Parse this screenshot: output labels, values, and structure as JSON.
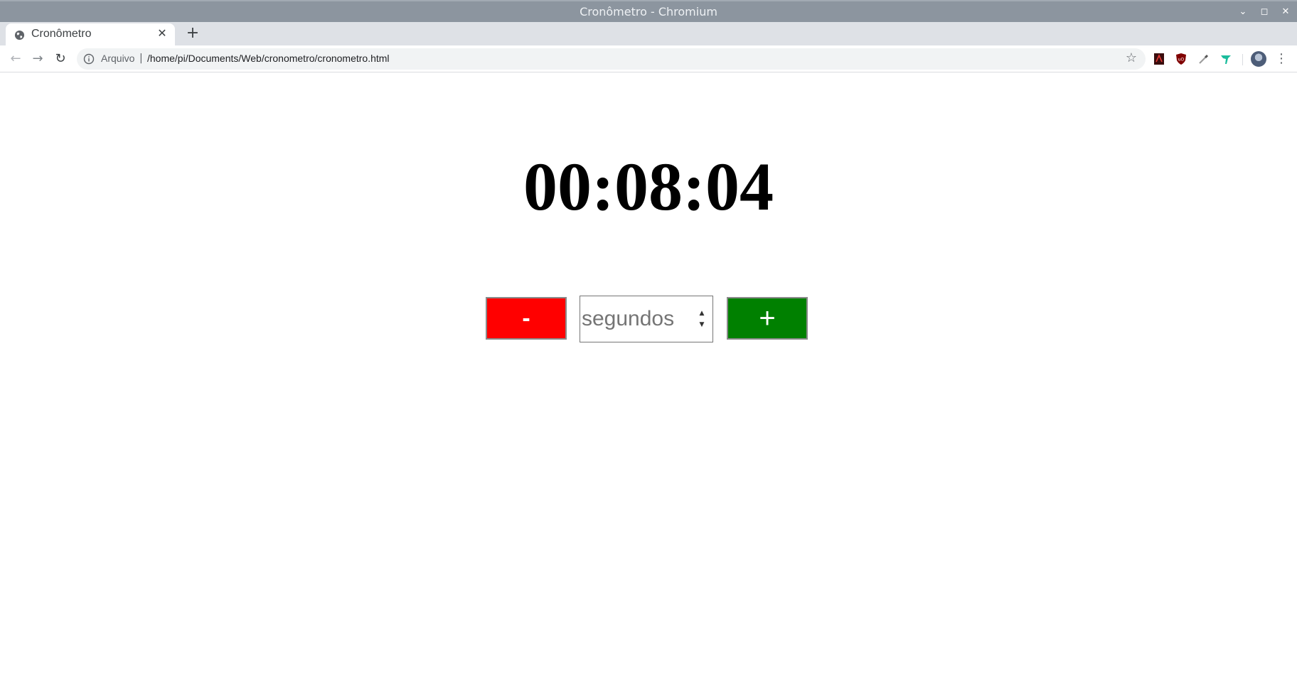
{
  "window": {
    "title": "Cronômetro - Chromium",
    "controls": {
      "minimize": "⌄",
      "maximize": "◻",
      "close": "✕"
    }
  },
  "tabs": [
    {
      "title": "Cronômetro",
      "icon": "globe-icon",
      "active": true
    }
  ],
  "tabstrip": {
    "new_tab": "+",
    "close": "✕"
  },
  "toolbar": {
    "back": "←",
    "forward": "→",
    "reload": "↻",
    "scheme_label": "Arquivo",
    "separator": "|",
    "url": "/home/pi/Documents/Web/cronometro/cronometro.html",
    "bookmark": "☆",
    "menu": "⋮",
    "extensions": [
      "pdf-extension-icon",
      "ublock-icon",
      "eyedropper-icon",
      "bird-extension-icon"
    ]
  },
  "page": {
    "clock": "00:08:04",
    "minus_button": "-",
    "seconds_input": {
      "value": "",
      "placeholder": "segundos"
    },
    "plus_button": "+"
  },
  "colors": {
    "minus": "#ff0000",
    "plus": "#008000",
    "titlebar": "#8c959f",
    "tabstrip": "#dee1e6"
  }
}
